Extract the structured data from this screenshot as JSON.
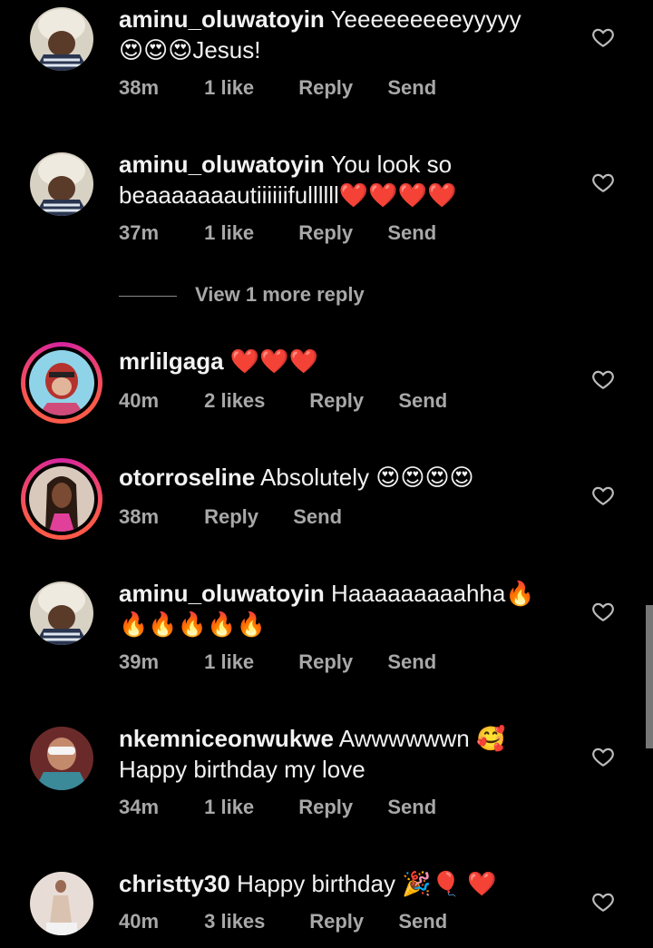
{
  "comments": [
    {
      "user": "aminu_oluwatoyin",
      "text": "Yeeeeeeeeeyyyyy ",
      "text2": "😍😍😍Jesus!",
      "time": "38m",
      "likes": "1 like",
      "reply": "Reply",
      "send": "Send",
      "avatar": "baby-avatar"
    },
    {
      "user": "aminu_oluwatoyin",
      "text": "You look so beaaaaaaautiiiiiifullllll❤️❤️❤️❤️",
      "time": "37m",
      "likes": "1 like",
      "reply": "Reply",
      "send": "Send",
      "avatar": "baby-avatar"
    },
    {
      "user": "mrlilgaga",
      "text": "❤️❤️❤️",
      "time": "40m",
      "likes": "2 likes",
      "reply": "Reply",
      "send": "Send",
      "avatar": "ape-avatar"
    },
    {
      "user": "otorroseline",
      "text": "Absolutely 😍😍😍😍",
      "time": "38m",
      "reply": "Reply",
      "send": "Send",
      "avatar": "woman-avatar"
    },
    {
      "user": "aminu_oluwatoyin",
      "text": "Haaaaaaaaahha🔥",
      "text2": "🔥🔥🔥🔥🔥",
      "time": "39m",
      "likes": "1 like",
      "reply": "Reply",
      "send": "Send",
      "avatar": "baby-avatar"
    },
    {
      "user": "nkemniceonwukwe",
      "text": "Awwwwwwn 🥰",
      "text2": "Happy birthday my love",
      "time": "34m",
      "likes": "1 like",
      "reply": "Reply",
      "send": "Send",
      "avatar": "woman2-avatar"
    },
    {
      "user": "christty30",
      "text": "Happy birthday 🎉🎈 ❤️",
      "time": "40m",
      "likes": "3 likes",
      "reply": "Reply",
      "send": "Send",
      "avatar": "woman3-avatar"
    }
  ],
  "view_more": "View 1 more reply",
  "colors": {
    "background": "#000000",
    "meta": "#a8a8a8",
    "text": "#f2f2f2"
  }
}
